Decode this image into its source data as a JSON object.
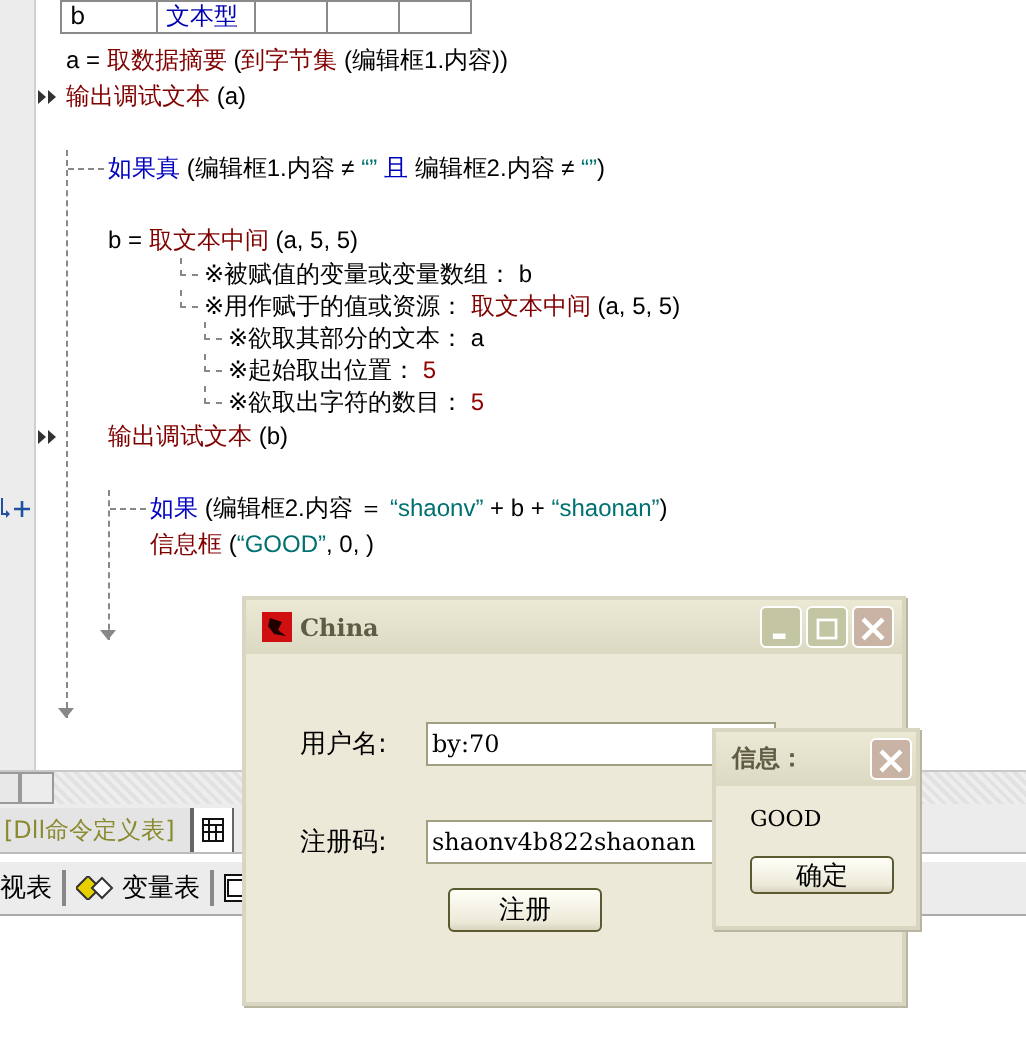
{
  "definition_table": {
    "rows": [
      {
        "cells": [
          {
            "kind": "name",
            "text": "b"
          },
          {
            "kind": "type",
            "text": "文本型"
          },
          {
            "kind": "empty"
          },
          {
            "kind": "empty"
          },
          {
            "kind": "empty"
          }
        ]
      }
    ]
  },
  "code_lines": [
    {
      "kind": "statement",
      "segments": [
        {
          "kind": "text",
          "text": "a = "
        },
        {
          "kind": "cmd",
          "text": "取数据摘要"
        },
        {
          "kind": "text",
          "text": " ("
        },
        {
          "kind": "cmd",
          "text": "到字节集"
        },
        {
          "kind": "text",
          "text": " (编辑框1.内容))"
        }
      ]
    },
    {
      "kind": "statement",
      "run_marker": true,
      "segments": [
        {
          "kind": "cmd",
          "text": "输出调试文本"
        },
        {
          "kind": "text",
          "text": " (a)"
        }
      ]
    },
    {
      "kind": "blank"
    },
    {
      "kind": "branch",
      "segments": [
        {
          "kind": "kw",
          "text": "如果真"
        },
        {
          "kind": "text",
          "text": " (编辑框1.内容 ≠ "
        },
        {
          "kind": "str",
          "text": "“”"
        },
        {
          "kind": "kw",
          "text": " 且"
        },
        {
          "kind": "text",
          "text": " 编辑框2.内容 ≠ "
        },
        {
          "kind": "str",
          "text": "“”"
        },
        {
          "kind": "text",
          "text": ")"
        }
      ],
      "children": [
        {
          "kind": "blank"
        },
        {
          "kind": "assign",
          "segments": [
            {
              "kind": "text",
              "text": "b = "
            },
            {
              "kind": "cmd",
              "text": "取文本中间"
            },
            {
              "kind": "text",
              "text": " (a, 5, 5)"
            }
          ],
          "children": [
            {
              "kind": "param",
              "segments": [
                {
                  "kind": "text",
                  "text": "※被赋值的变量或变量数组： b"
                }
              ]
            },
            {
              "kind": "param",
              "segments": [
                {
                  "kind": "text",
                  "text": "※用作赋于的值或资源： "
                },
                {
                  "kind": "cmd",
                  "text": "取文本中间"
                },
                {
                  "kind": "text",
                  "text": " (a, 5, 5)"
                }
              ],
              "children": [
                {
                  "kind": "param",
                  "segments": [
                    {
                      "kind": "text",
                      "text": "※欲取其部分的文本： a"
                    }
                  ]
                },
                {
                  "kind": "param",
                  "segments": [
                    {
                      "kind": "text",
                      "text": "※起始取出位置： "
                    },
                    {
                      "kind": "num",
                      "text": "5"
                    }
                  ]
                },
                {
                  "kind": "param",
                  "segments": [
                    {
                      "kind": "text",
                      "text": "※欲取出字符的数目： "
                    },
                    {
                      "kind": "num",
                      "text": "5"
                    }
                  ]
                }
              ]
            }
          ]
        },
        {
          "kind": "statement",
          "run_marker": true,
          "segments": [
            {
              "kind": "cmd",
              "text": "输出调试文本"
            },
            {
              "kind": "text",
              "text": " (b)"
            }
          ]
        },
        {
          "kind": "blank"
        },
        {
          "kind": "branch",
          "expand_marker": true,
          "segments": [
            {
              "kind": "kw",
              "text": "如果"
            },
            {
              "kind": "text",
              "text": " (编辑框2.内容 ＝ "
            },
            {
              "kind": "str",
              "text": "“shaonv”"
            },
            {
              "kind": "text",
              "text": " + b + "
            },
            {
              "kind": "str",
              "text": "“shaonan”"
            },
            {
              "kind": "text",
              "text": ")"
            }
          ],
          "children": [
            {
              "kind": "statement",
              "segments": [
                {
                  "kind": "cmd",
                  "text": "信息框"
                },
                {
                  "kind": "text",
                  "text": " ("
                },
                {
                  "kind": "str",
                  "text": "“GOOD”"
                },
                {
                  "kind": "text",
                  "text": ", 0, )"
                }
              ]
            }
          ]
        }
      ]
    }
  ],
  "bottom_tabs": [
    {
      "label": "[Dll命令定义表]",
      "selected": false
    },
    {
      "selected": true
    }
  ],
  "panel_bar": [
    {
      "kind": "text",
      "label": "视表"
    },
    {
      "kind": "icon-text",
      "label": "变量表"
    },
    {
      "kind": "icon"
    }
  ],
  "dialog": {
    "title": "China",
    "fields": [
      {
        "label": "用户名:",
        "value": "by:70"
      },
      {
        "label": "注册码:",
        "value": "shaonv4b822shaonan"
      }
    ],
    "button": "注册"
  },
  "message_box": {
    "title": "信息：",
    "message": "GOOD",
    "button": "确定"
  }
}
